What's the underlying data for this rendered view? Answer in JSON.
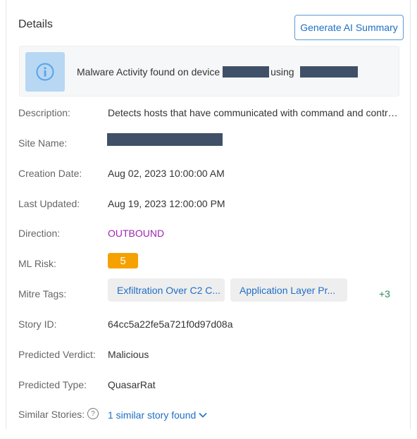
{
  "panel": {
    "title": "Details",
    "ai_summary_label": "Generate AI Summary"
  },
  "alert": {
    "text_prefix": "Malware Activity found on device",
    "text_using": "using",
    "icon": "info-icon"
  },
  "fields": {
    "description": {
      "label": "Description:",
      "value": "Detects hosts that have communicated with command and control servers"
    },
    "site_name": {
      "label": "Site Name:"
    },
    "creation_date": {
      "label": "Creation Date:",
      "value": "Aug 02, 2023 10:00:00 AM"
    },
    "last_updated": {
      "label": "Last Updated:",
      "value": "Aug 19, 2023 12:00:00 PM"
    },
    "direction": {
      "label": "Direction:",
      "value": "OUTBOUND"
    },
    "ml_risk": {
      "label": "ML Risk:",
      "value": "5"
    },
    "mitre_tags": {
      "label": "Mitre Tags:",
      "tags": [
        "Exfiltration Over C2 C...",
        "Application Layer Pr..."
      ],
      "more": "+3"
    },
    "story_id": {
      "label": "Story ID:",
      "value": "64cc5a22fe5a721f0d97d08a"
    },
    "predicted_verdict": {
      "label": "Predicted Verdict:",
      "value": "Malicious"
    },
    "predicted_type": {
      "label": "Predicted Type:",
      "value": "QuasarRat"
    },
    "similar_stories": {
      "label": "Similar Stories:",
      "link": "1 similar story found"
    }
  },
  "colors": {
    "accent": "#1f6fc5",
    "direction": "#9c27b0",
    "risk_badge": "#f5a100",
    "more_tags": "#2e8b57",
    "info_bg": "#b7d7f3"
  }
}
